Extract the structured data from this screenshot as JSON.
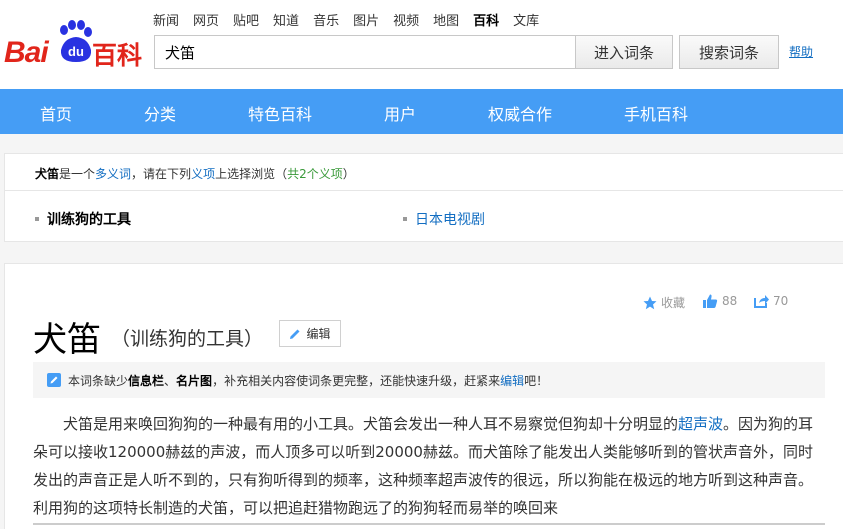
{
  "header": {
    "logo_bai": "Bai",
    "logo_du": "du",
    "logo_baike": "百科",
    "topnav": [
      "新闻",
      "网页",
      "贴吧",
      "知道",
      "音乐",
      "图片",
      "视频",
      "地图",
      "百科",
      "文库"
    ],
    "search_value": "犬笛",
    "enter_button": "进入词条",
    "search_button": "搜索词条",
    "help_link": "帮助"
  },
  "mainnav": [
    "首页",
    "分类",
    "特色百科",
    "用户",
    "权威合作",
    "手机百科"
  ],
  "polysemy": {
    "head_term": "犬笛",
    "head_text_1": "是一个",
    "head_link": "多义词",
    "head_text_2": "，请在下列",
    "head_yixiang": "义项",
    "head_text_3": "上选择浏览（",
    "head_count": "共2个义项",
    "head_text_4": "）",
    "items": [
      "训练狗的工具",
      "日本电视剧"
    ]
  },
  "article": {
    "stats": {
      "collect": "收藏",
      "likes": "88",
      "shares": "70"
    },
    "title": "犬笛",
    "subtitle": "（训练狗的工具）",
    "edit_label": "编辑",
    "notice_text_1": "本词条缺少",
    "notice_bold_1": "信息栏",
    "notice_sep": "、",
    "notice_bold_2": "名片图",
    "notice_text_2": "，补充相关内容使词条更完整，还能快速升级，赶紧来",
    "notice_link": "编辑",
    "notice_text_3": "吧！",
    "para_1": "犬笛是用来唤回狗狗的一种最有用的小工具。犬笛会发出一种人耳不易察觉但狗却十分明显的",
    "para_link": "超声波",
    "para_2": "。因为狗的耳朵可以接收120000赫兹的声波，而人顶多可以听到20000赫兹。而犬笛除了能发出人类能够听到的管状声音外，同时发出的声音正是人听不到的，只有狗听得到的频率，这种频率超声波传的很远，所以狗能在极远的地方听到这种声音。利用狗的这项特长制造的犬笛，可以把追赶猎物跑远了的狗狗轻而易举的唤回来"
  },
  "colors": {
    "brand_red": "#e1251b",
    "brand_blue": "#2932e1",
    "nav_blue": "#459df5",
    "link_blue": "#136ec2"
  }
}
